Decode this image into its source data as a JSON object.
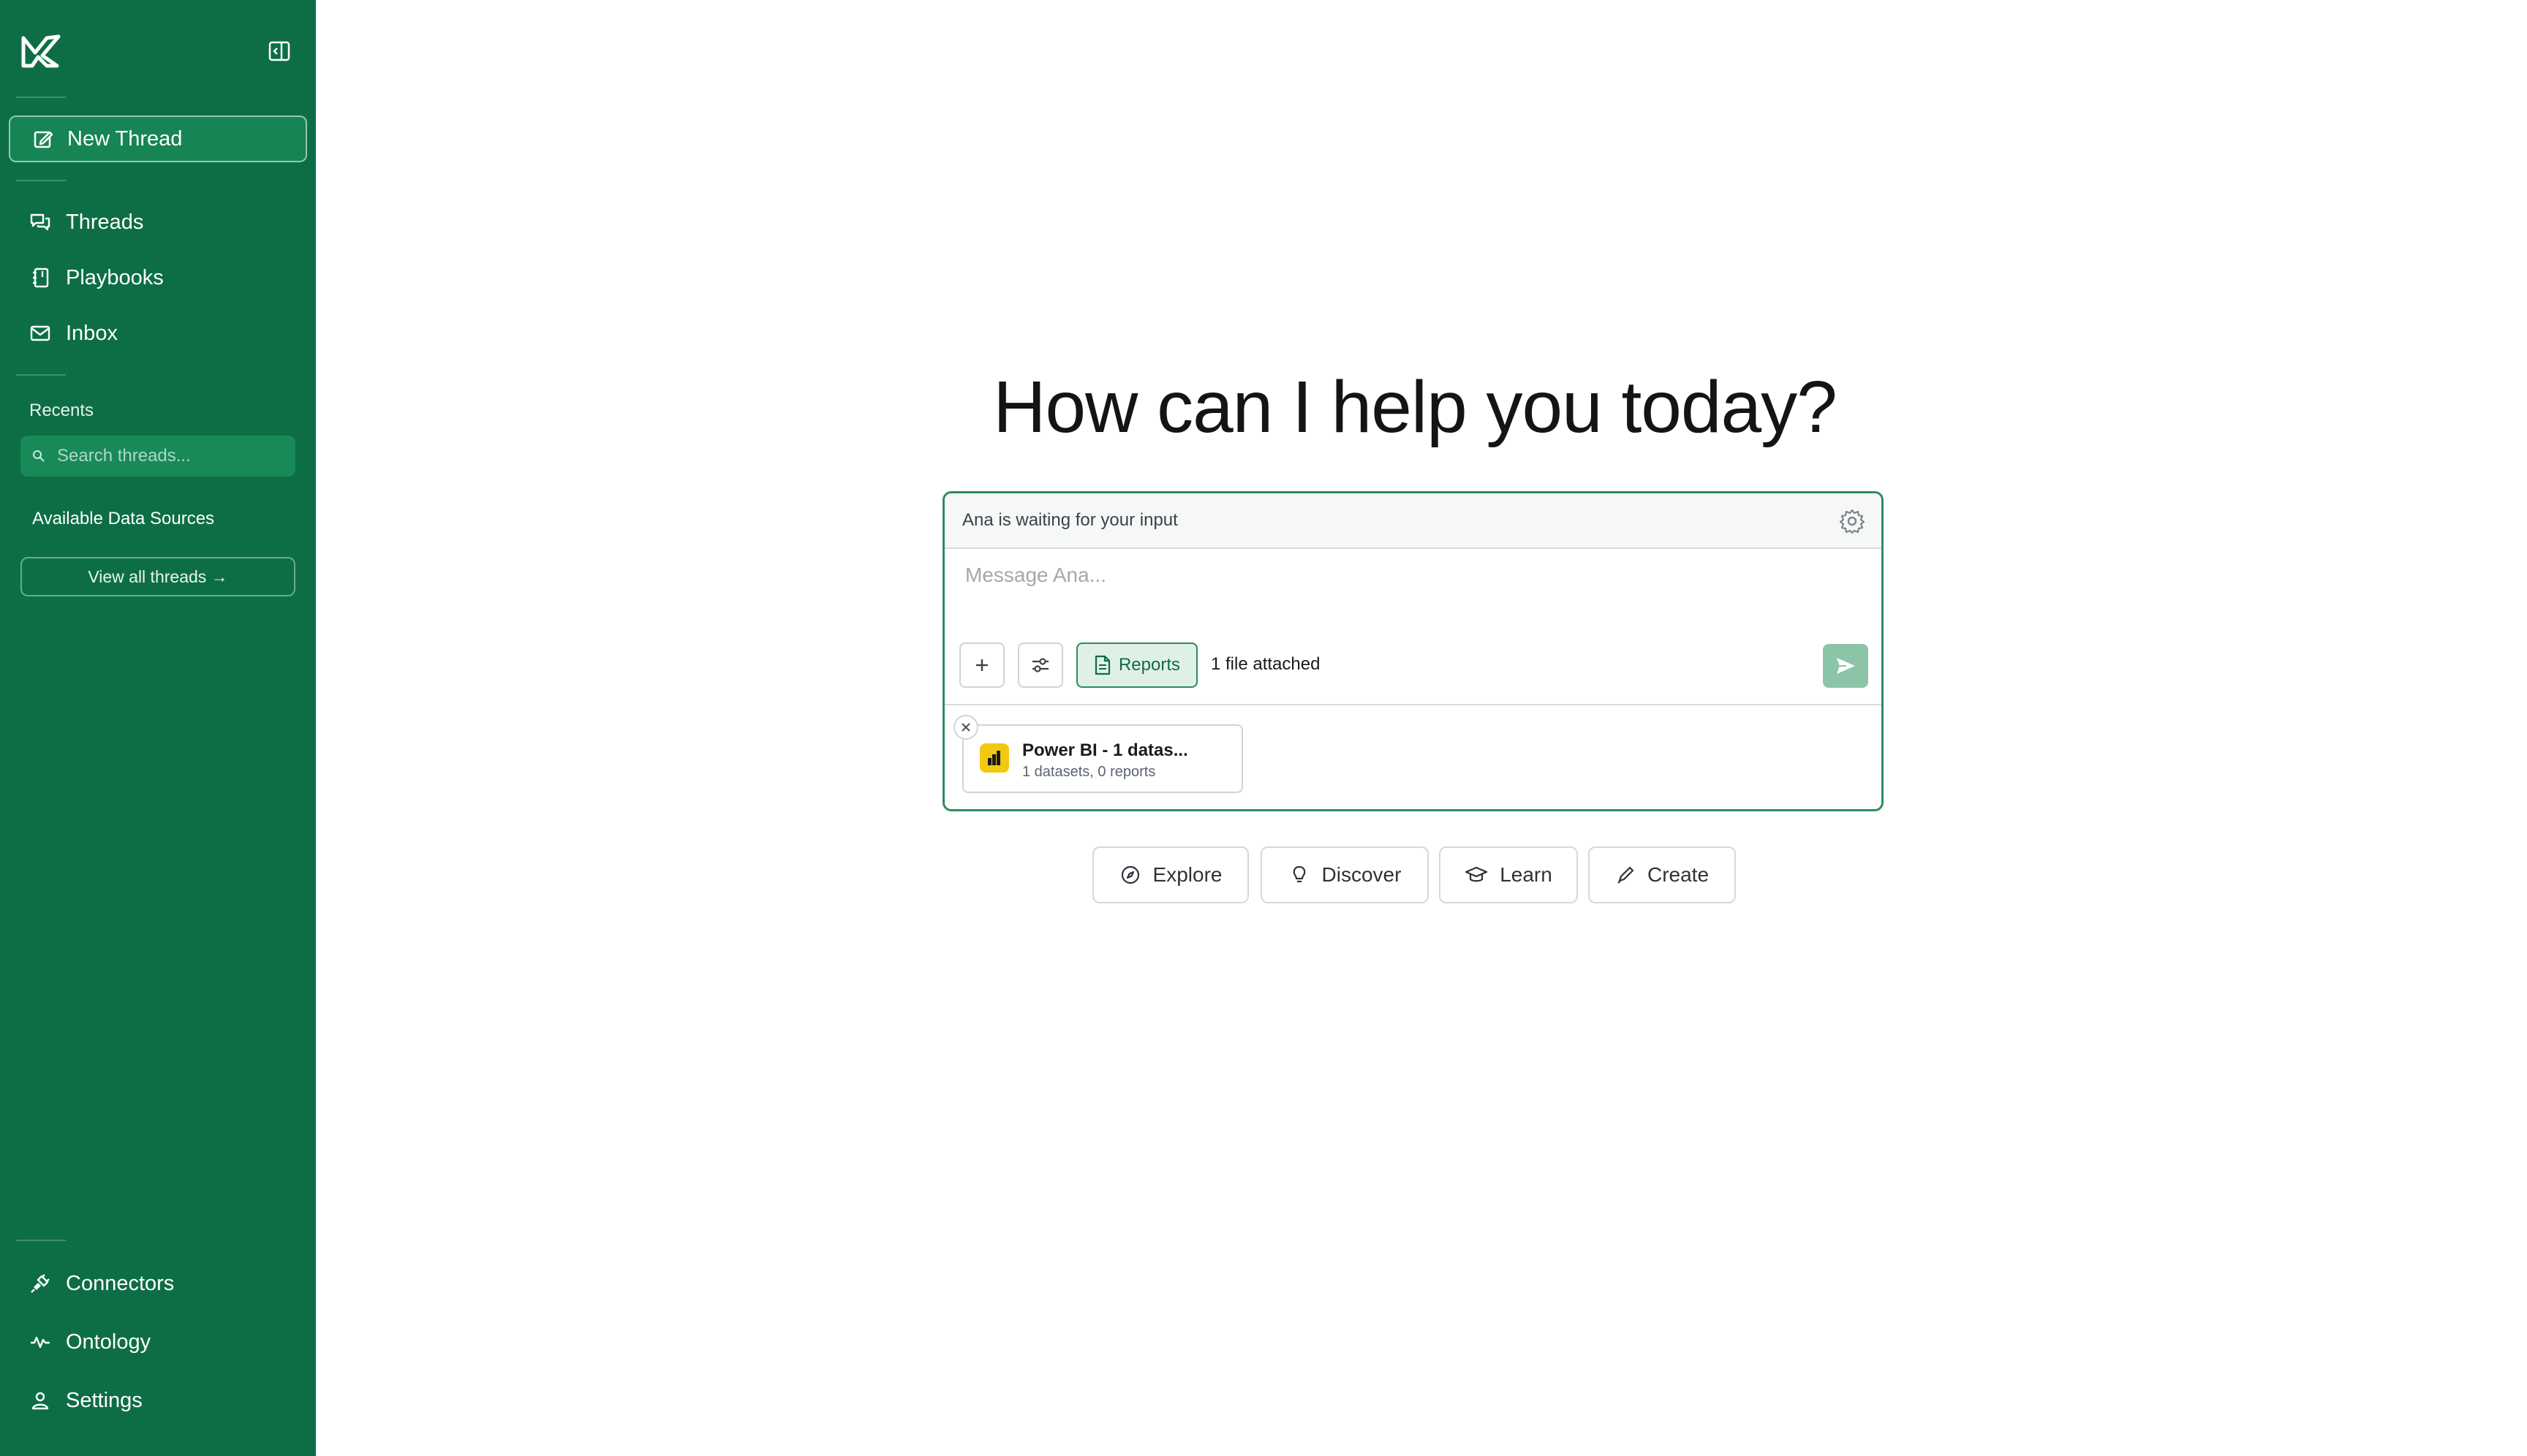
{
  "sidebar": {
    "new_thread": "New Thread",
    "nav": [
      {
        "label": "Threads",
        "icon": "threads-icon"
      },
      {
        "label": "Playbooks",
        "icon": "playbooks-icon"
      },
      {
        "label": "Inbox",
        "icon": "inbox-icon"
      }
    ],
    "recents_title": "Recents",
    "search_placeholder": "Search threads...",
    "data_sources_title": "Available Data Sources",
    "view_all": "View all threads →",
    "bottom_nav": [
      {
        "label": "Connectors",
        "icon": "connectors-icon"
      },
      {
        "label": "Ontology",
        "icon": "ontology-icon"
      },
      {
        "label": "Settings",
        "icon": "settings-user-icon"
      }
    ]
  },
  "main": {
    "headline": "How can I help you today?",
    "composer": {
      "status": "Ana is waiting for your input",
      "placeholder": "Message Ana...",
      "reports_label": "Reports",
      "attached_text": "1 file attached",
      "attachment": {
        "title": "Power BI - 1 datas...",
        "subtitle": "1 datasets, 0 reports"
      }
    },
    "quick_actions": [
      {
        "label": "Explore",
        "icon": "compass-icon"
      },
      {
        "label": "Discover",
        "icon": "lightbulb-icon"
      },
      {
        "label": "Learn",
        "icon": "graduation-cap-icon"
      },
      {
        "label": "Create",
        "icon": "pen-icon"
      }
    ]
  },
  "colors": {
    "sidebar_bg": "#0d6e45",
    "accent": "#2e8b5d",
    "send_button": "#8cc4a7",
    "powerbi_yellow": "#f2c811"
  }
}
